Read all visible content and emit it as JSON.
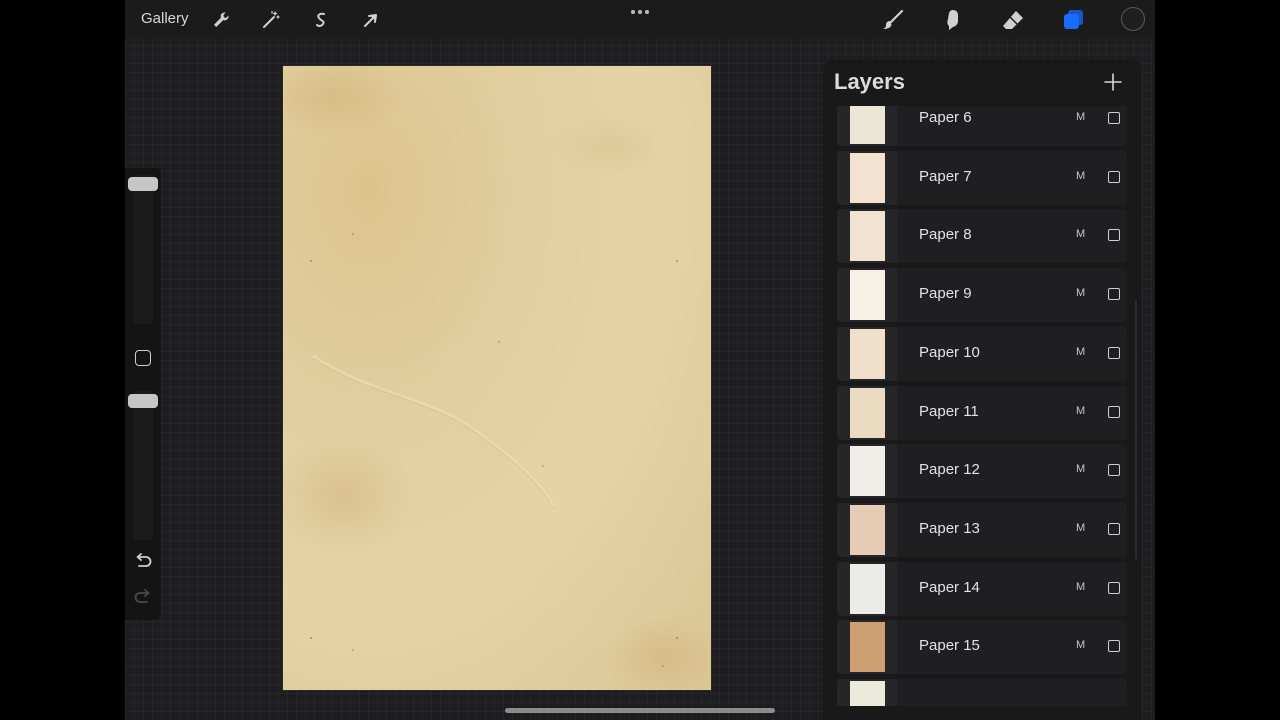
{
  "toolbar": {
    "gallery_label": "Gallery",
    "left_icons": [
      "wrench-icon",
      "magic-wand-icon",
      "selection-icon",
      "arrow-cursor-icon"
    ],
    "right_icons": [
      "brush-icon",
      "smudge-icon",
      "eraser-icon",
      "layers-icon"
    ],
    "active_tool": "layers",
    "current_color": "#1f1f1f",
    "accent_color": "#1a6cff"
  },
  "sidebar": {
    "size_slider_level": 0.05,
    "opacity_slider_level": 0.05,
    "undo_icon": "undo-icon",
    "redo_icon": "redo-icon",
    "modify_icon": "square-icon"
  },
  "layers": {
    "title": "Layers",
    "add_icon": "plus-icon",
    "items": [
      {
        "name": "Paper 6",
        "mode": "M",
        "thumb_color": "#ebe6d6"
      },
      {
        "name": "Paper 7",
        "mode": "M",
        "thumb_color": "#f2e2cf"
      },
      {
        "name": "Paper 8",
        "mode": "M",
        "thumb_color": "#f1e3cf"
      },
      {
        "name": "Paper 9",
        "mode": "M",
        "thumb_color": "#f6f1e4"
      },
      {
        "name": "Paper 10",
        "mode": "M",
        "thumb_color": "#f0dfca"
      },
      {
        "name": "Paper 11",
        "mode": "M",
        "thumb_color": "#eadbc1"
      },
      {
        "name": "Paper 12",
        "mode": "M",
        "thumb_color": "#f1eeea"
      },
      {
        "name": "Paper 13",
        "mode": "M",
        "thumb_color": "#e6ccb5"
      },
      {
        "name": "Paper 14",
        "mode": "M",
        "thumb_color": "#ebebe8"
      },
      {
        "name": "Paper 15",
        "mode": "M",
        "thumb_color": "#cf9f74"
      },
      {
        "name": "",
        "mode": "",
        "thumb_color": "#ecebdb"
      }
    ]
  },
  "canvas": {
    "paper_color": "#e3cf9f"
  }
}
